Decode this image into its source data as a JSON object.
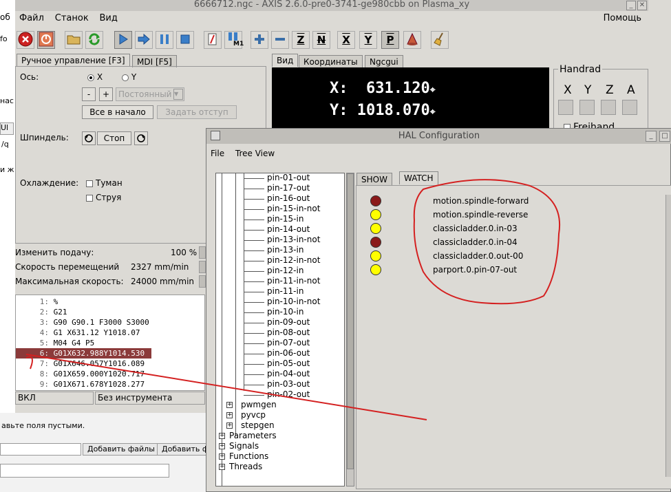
{
  "browser_bg": {
    "left_fragments": [
      "об",
      "fo",
      "нас",
      "Ul",
      "/q",
      "и ж"
    ],
    "hint_text": "авьте поля пустыми.",
    "add_files": "Добавить файлы",
    "add_files_2": "Добавить фа"
  },
  "axis": {
    "title": "6666712.ngc - AXIS 2.6.0-pre0-3741-ge980cbb on Plasma_xy",
    "menu": [
      "Файл",
      "Станок",
      "Вид"
    ],
    "help": "Помощь",
    "toolbar_text": {
      "touch_z": "Z",
      "x": "X",
      "y": "Y",
      "p": "P",
      "m1": "M1"
    },
    "tabs_left": [
      "Ручное управление [F3]",
      "MDI [F5]"
    ],
    "tabs_right": [
      "Вид",
      "Координаты",
      "Ngcgui"
    ],
    "manual": {
      "axis_label": "Ось:",
      "axis_x": "X",
      "axis_y": "Y",
      "minus": "-",
      "plus": "+",
      "jog_mode": "Постоянный",
      "home_all": "Все в начало",
      "touch_off": "Задать отступ",
      "spindle_label": "Шпиндель:",
      "stop": "Стоп",
      "coolant_label": "Охлаждение:",
      "mist": "Туман",
      "flood": "Струя"
    },
    "overrides": [
      {
        "label": "Изменить подачу:",
        "value": "100 %"
      },
      {
        "label": "Скорость перемещений",
        "value": "2327 mm/min"
      },
      {
        "label": "Максимальная скорость:",
        "value": "24000 mm/min"
      }
    ],
    "dro": [
      {
        "axis": "X:",
        "value": "631.120"
      },
      {
        "axis": "Y:",
        "value": "1018.070"
      }
    ],
    "handrad": {
      "title": "Handrad",
      "axes": [
        "X",
        "Y",
        "Z",
        "A"
      ],
      "freihand": "Freihand"
    },
    "gcode": [
      {
        "n": "1:",
        "code": "%"
      },
      {
        "n": "2:",
        "code": "G21"
      },
      {
        "n": "3:",
        "code": "G90 G90.1 F3000 S3000"
      },
      {
        "n": "4:",
        "code": "G1 X631.12 Y1018.07"
      },
      {
        "n": "5:",
        "code": "M04 G4 P5"
      },
      {
        "n": "6:",
        "code": "G01X632.988Y1014.530"
      },
      {
        "n": "7:",
        "code": "G01X646.057Y1016.089"
      },
      {
        "n": "8:",
        "code": "G01X659.000Y1020.717"
      },
      {
        "n": "9:",
        "code": "G01X671.678Y1028.277"
      }
    ],
    "current_line": 6,
    "status": {
      "state": "ВКЛ",
      "tool": "Без инструмента"
    }
  },
  "hal": {
    "title": "HAL Configuration",
    "menu": [
      "File",
      "Tree View"
    ],
    "tabs": [
      "SHOW",
      "WATCH"
    ],
    "active_tab": "WATCH",
    "pins": [
      "pin-01-out",
      "pin-17-out",
      "pin-16-out",
      "pin-15-in-not",
      "pin-15-in",
      "pin-14-out",
      "pin-13-in-not",
      "pin-13-in",
      "pin-12-in-not",
      "pin-12-in",
      "pin-11-in-not",
      "pin-11-in",
      "pin-10-in-not",
      "pin-10-in",
      "pin-09-out",
      "pin-08-out",
      "pin-07-out",
      "pin-06-out",
      "pin-05-out",
      "pin-04-out",
      "pin-03-out",
      "pin-02-out"
    ],
    "sub_nodes": [
      "pwmgen",
      "pyvcp",
      "stepgen"
    ],
    "top_nodes": [
      "Parameters",
      "Signals",
      "Functions",
      "Threads"
    ],
    "watch": [
      {
        "name": "motion.spindle-forward",
        "color": "#8b1a1a"
      },
      {
        "name": "motion.spindle-reverse",
        "color": "#ffff00"
      },
      {
        "name": "classicladder.0.in-03",
        "color": "#ffff00"
      },
      {
        "name": "classicladder.0.in-04",
        "color": "#8b1a1a"
      },
      {
        "name": "classicladder.0.out-00",
        "color": "#ffff00"
      },
      {
        "name": "parport.0.pin-07-out",
        "color": "#ffff00"
      }
    ]
  },
  "colors": {
    "annotation": "#d42020",
    "dro_bg": "#000000",
    "current_line": "#8b3a3a"
  }
}
